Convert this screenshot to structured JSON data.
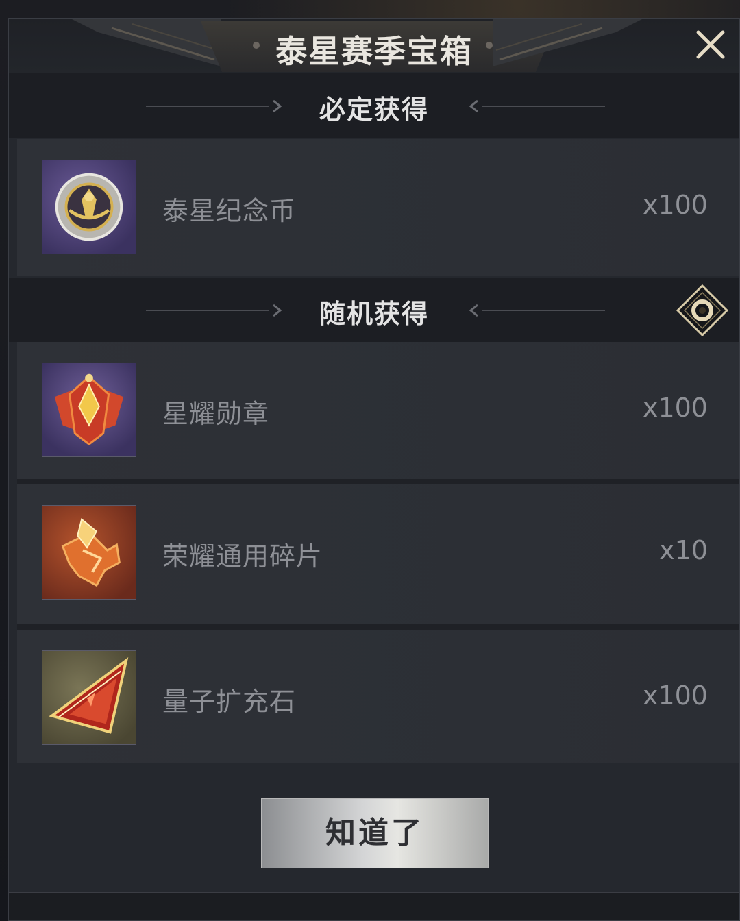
{
  "dialog": {
    "title": "泰星赛季宝箱",
    "close_icon": "close-icon"
  },
  "guaranteed": {
    "label": "必定获得",
    "items": [
      {
        "name": "泰星纪念币",
        "qty": "x100",
        "icon": "commemorative-coin-icon"
      }
    ]
  },
  "random": {
    "label": "随机获得",
    "info_icon": "info-icon",
    "items": [
      {
        "name": "星耀勋章",
        "qty": "x100",
        "icon": "star-medal-icon"
      },
      {
        "name": "荣耀通用碎片",
        "qty": "x10",
        "icon": "glory-fragment-icon"
      },
      {
        "name": "量子扩充石",
        "qty": "x100",
        "icon": "quantum-stone-icon"
      }
    ]
  },
  "actions": {
    "confirm_label": "知道了"
  },
  "colors": {
    "panel": "#25282e",
    "section": "#1c1e23",
    "text_muted": "#8e9096",
    "accent_gold": "#c9a24a"
  }
}
